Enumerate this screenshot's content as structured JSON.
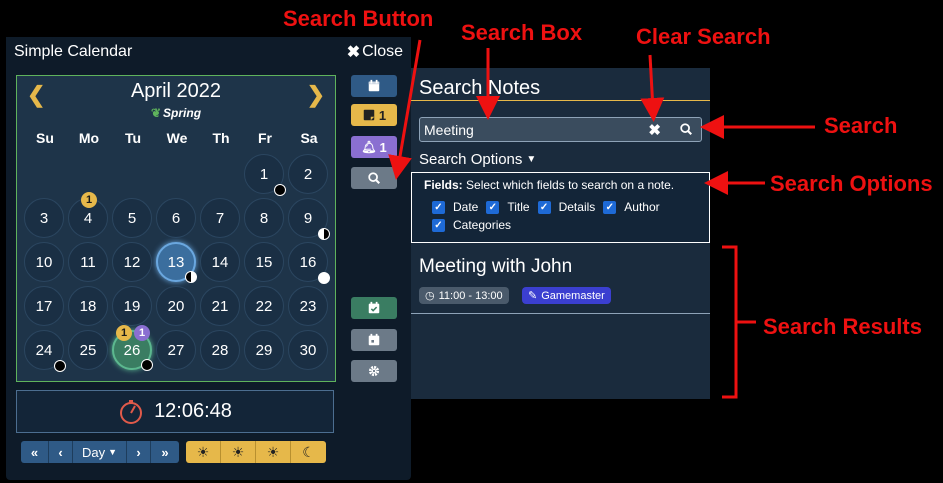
{
  "window": {
    "title": "Simple Calendar",
    "close_label": "Close"
  },
  "calendar": {
    "month_label": "April 2022",
    "season_label": "Spring",
    "weekdays": [
      "Su",
      "Mo",
      "Tu",
      "We",
      "Th",
      "Fr",
      "Sa"
    ],
    "weeks": [
      [
        "",
        "",
        "",
        "",
        "",
        "1",
        "2"
      ],
      [
        "3",
        "4",
        "5",
        "6",
        "7",
        "8",
        "9"
      ],
      [
        "10",
        "11",
        "12",
        "13",
        "14",
        "15",
        "16"
      ],
      [
        "17",
        "18",
        "19",
        "20",
        "21",
        "22",
        "23"
      ],
      [
        "24",
        "25",
        "26",
        "27",
        "28",
        "29",
        "30"
      ]
    ],
    "today": "13",
    "selected": "26",
    "badges": {
      "day4_notes": "1",
      "day26_notes": "1",
      "day26_reminders": "1"
    }
  },
  "side_buttons": {
    "notes_count": "1",
    "reminders_count": "1"
  },
  "clock": {
    "time": "12:06:48"
  },
  "bottom_bar": {
    "unit_label": "Day"
  },
  "search": {
    "title": "Search Notes",
    "query": "Meeting",
    "options_label": "Search Options",
    "fields_label": "Fields:",
    "fields_hint": "Select which fields to search on a note.",
    "fields": [
      "Date",
      "Title",
      "Details",
      "Author",
      "Categories"
    ],
    "result": {
      "title": "Meeting with John",
      "time": "11:00 - 13:00",
      "author": "Gamemaster"
    }
  },
  "annotations": {
    "search_button": "Search Button",
    "search_box": "Search Box",
    "clear_search": "Clear Search",
    "search": "Search",
    "search_options": "Search Options",
    "search_results": "Search Results"
  },
  "colors": {
    "accent_yellow": "#e6b84a",
    "panel_bg": "#1a2b3d",
    "calendar_border": "#5fb35c",
    "annotation_red": "#ee1111"
  }
}
